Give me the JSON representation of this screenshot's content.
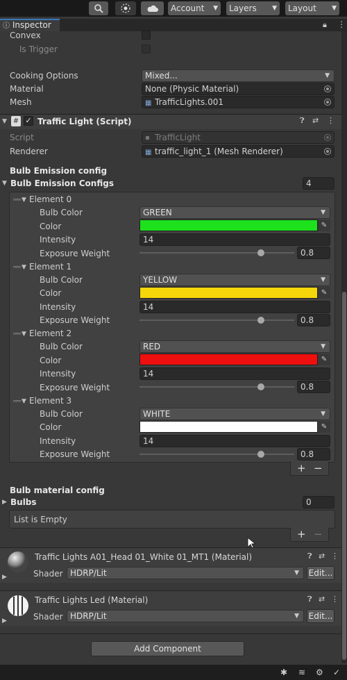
{
  "toolbar": {
    "search_icon": "search-icon",
    "services_icon": "services-icon",
    "cloud_icon": "cloud-icon",
    "account_label": "Account",
    "layers_label": "Layers",
    "layout_label": "Layout"
  },
  "tab": {
    "label": "Inspector"
  },
  "collider": {
    "convex_label": "Convex",
    "is_trigger_label": "Is Trigger",
    "cooking_label": "Cooking Options",
    "cooking_value": "Mixed...",
    "material_label": "Material",
    "material_value": "None (Physic Material)",
    "mesh_label": "Mesh",
    "mesh_value": "TrafficLights.001"
  },
  "script_component": {
    "title": "Traffic Light (Script)",
    "script_label": "Script",
    "script_value": "TrafficLight",
    "renderer_label": "Renderer",
    "renderer_value": "traffic_light_1 (Mesh Renderer)",
    "emission_section": "Bulb Emission config",
    "emission_list_label": "Bulb Emission Configs",
    "emission_count": "4",
    "bulb_color_label": "Bulb Color",
    "color_label": "Color",
    "intensity_label": "Intensity",
    "exposure_label": "Exposure Weight",
    "elements": [
      {
        "name": "Element 0",
        "bulb_color": "GREEN",
        "color": "#1ee11e",
        "intensity": "14",
        "exposure": "0.8"
      },
      {
        "name": "Element 1",
        "bulb_color": "YELLOW",
        "color": "#f5d60a",
        "intensity": "14",
        "exposure": "0.8"
      },
      {
        "name": "Element 2",
        "bulb_color": "RED",
        "color": "#ee0f0f",
        "intensity": "14",
        "exposure": "0.8"
      },
      {
        "name": "Element 3",
        "bulb_color": "WHITE",
        "color": "#ffffff",
        "intensity": "14",
        "exposure": "0.8"
      }
    ],
    "material_section": "Bulb material config",
    "bulbs_label": "Bulbs",
    "bulbs_count": "0",
    "empty_text": "List is Empty",
    "plus": "+",
    "minus": "−"
  },
  "materials": [
    {
      "name": "Traffic Lights A01_Head 01_White 01_MT1 (Material)",
      "shader_label": "Shader",
      "shader_value": "HDRP/Lit",
      "edit_label": "Edit..."
    },
    {
      "name": "Traffic Lights Led (Material)",
      "shader_label": "Shader",
      "shader_value": "HDRP/Lit",
      "edit_label": "Edit..."
    }
  ],
  "add_component_label": "Add Component"
}
